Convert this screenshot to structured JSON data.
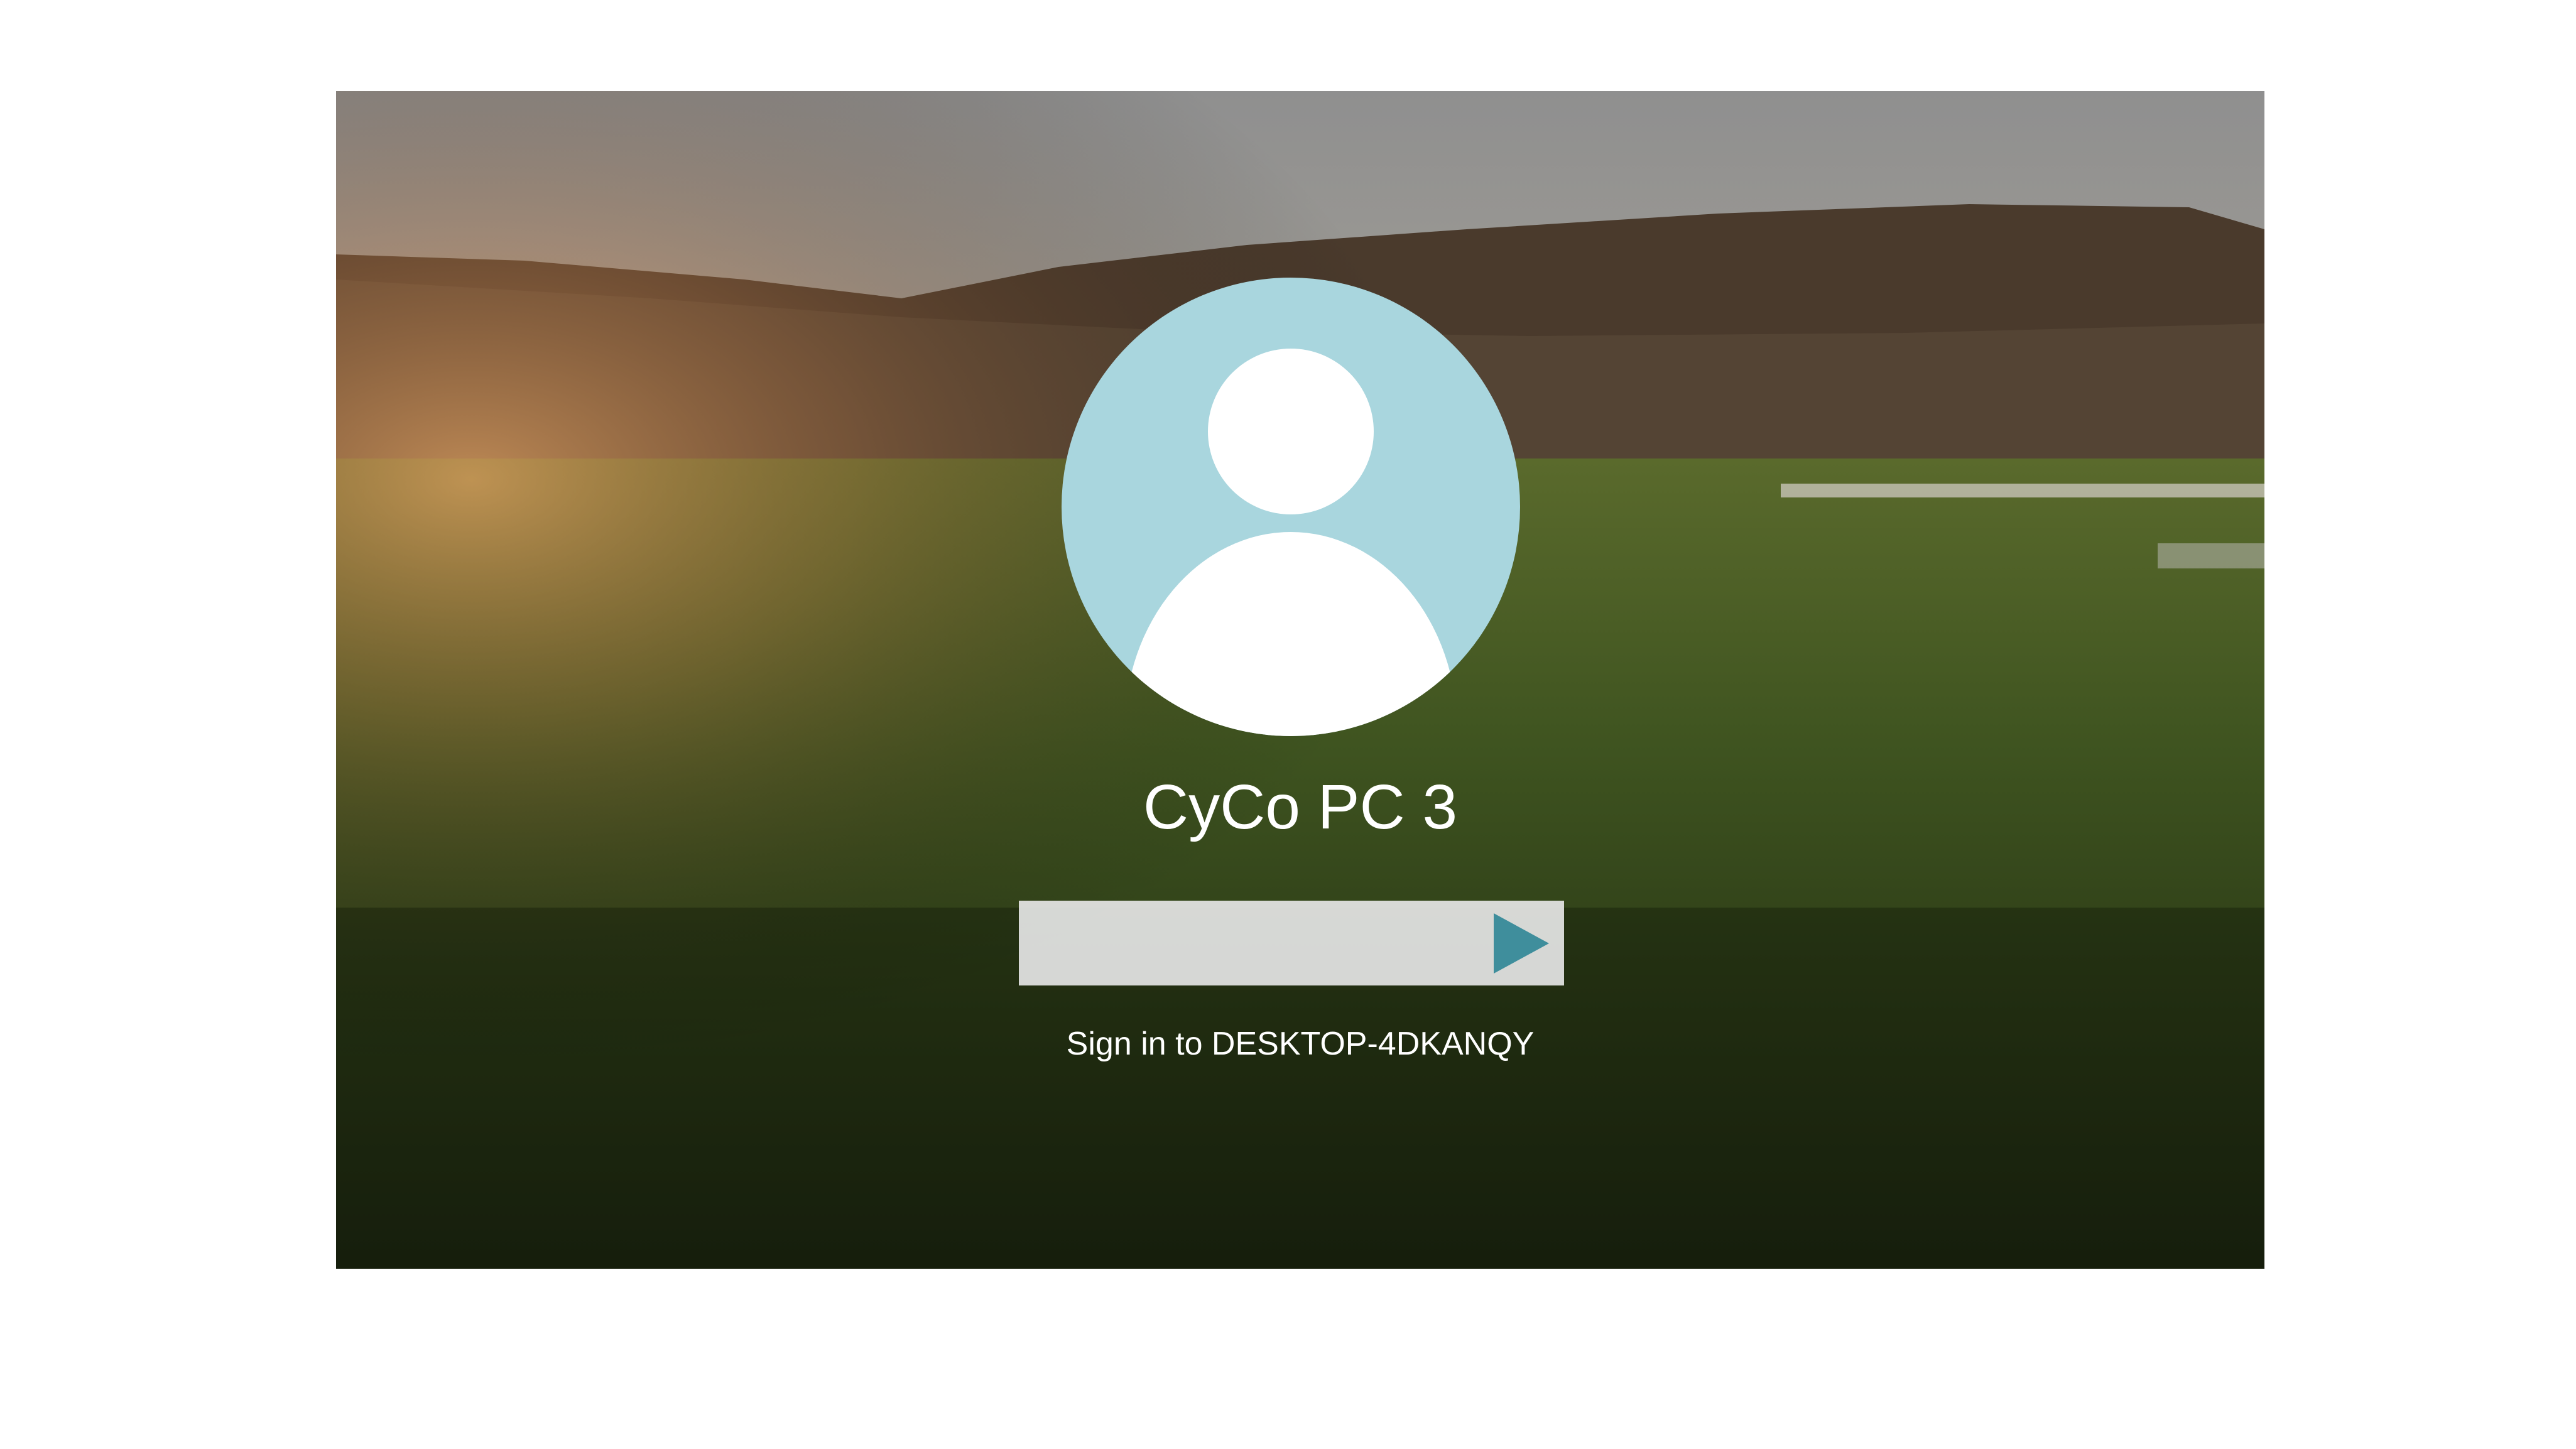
{
  "login": {
    "username": "CyCo PC 3",
    "password_placeholder": "",
    "sign_in_text": "Sign in to DESKTOP-4DKANQY"
  },
  "icons": {
    "avatar": "user-avatar-icon",
    "submit": "arrow-right-icon"
  },
  "colors": {
    "avatar_bg": "#a9d6de",
    "submit_arrow": "#3f8e9c",
    "password_box": "#e6e6e6",
    "page_bg": "#ffffff"
  }
}
